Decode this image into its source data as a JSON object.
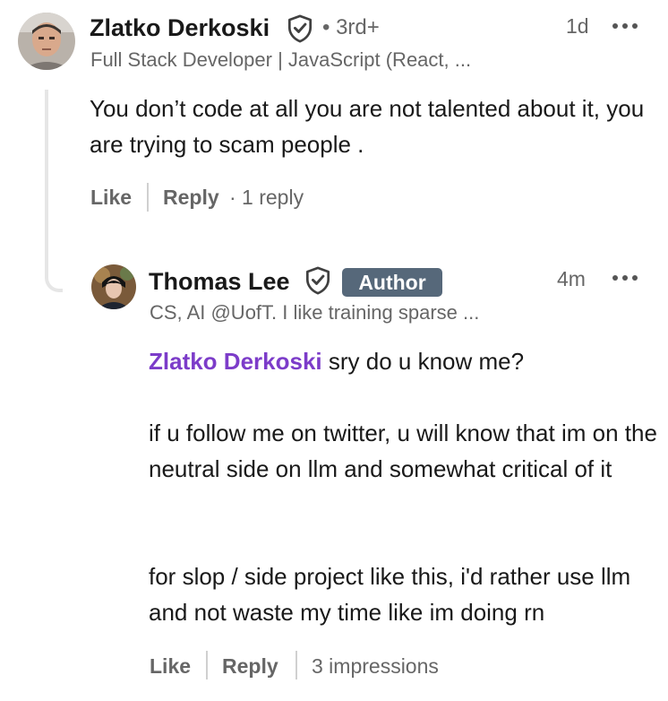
{
  "comment": {
    "author_name": "Zlatko Derkoski",
    "degree": "• 3rd+",
    "headline": "Full Stack Developer | JavaScript (React, ...",
    "time": "1d",
    "text": "You don’t code at all you are not talented about it, you are trying to scam people .",
    "like_label": "Like",
    "reply_label": "Reply",
    "reply_count": "· 1 reply"
  },
  "reply": {
    "author_name": "Thomas Lee",
    "badge": "Author",
    "headline": "CS, AI @UofT. I like training sparse ...",
    "time": "4m",
    "mention": "Zlatko Derkoski",
    "text_after_mention": "sry do u know me?",
    "paragraph2": "if u follow me on twitter, u will know that im on the neutral side on llm and somewhat critical of it",
    "paragraph3": "for slop / side project like this, i'd rather use llm and not waste my time like im doing rn",
    "like_label": "Like",
    "reply_label": "Reply",
    "impressions": "3 impressions"
  },
  "icons": {
    "verified": "shield-check-icon",
    "more": "more-horizontal-icon"
  },
  "colors": {
    "mention": "#7c3cc9",
    "author_badge": "#56687a",
    "secondary_text": "#666666",
    "primary_text": "#191919"
  }
}
